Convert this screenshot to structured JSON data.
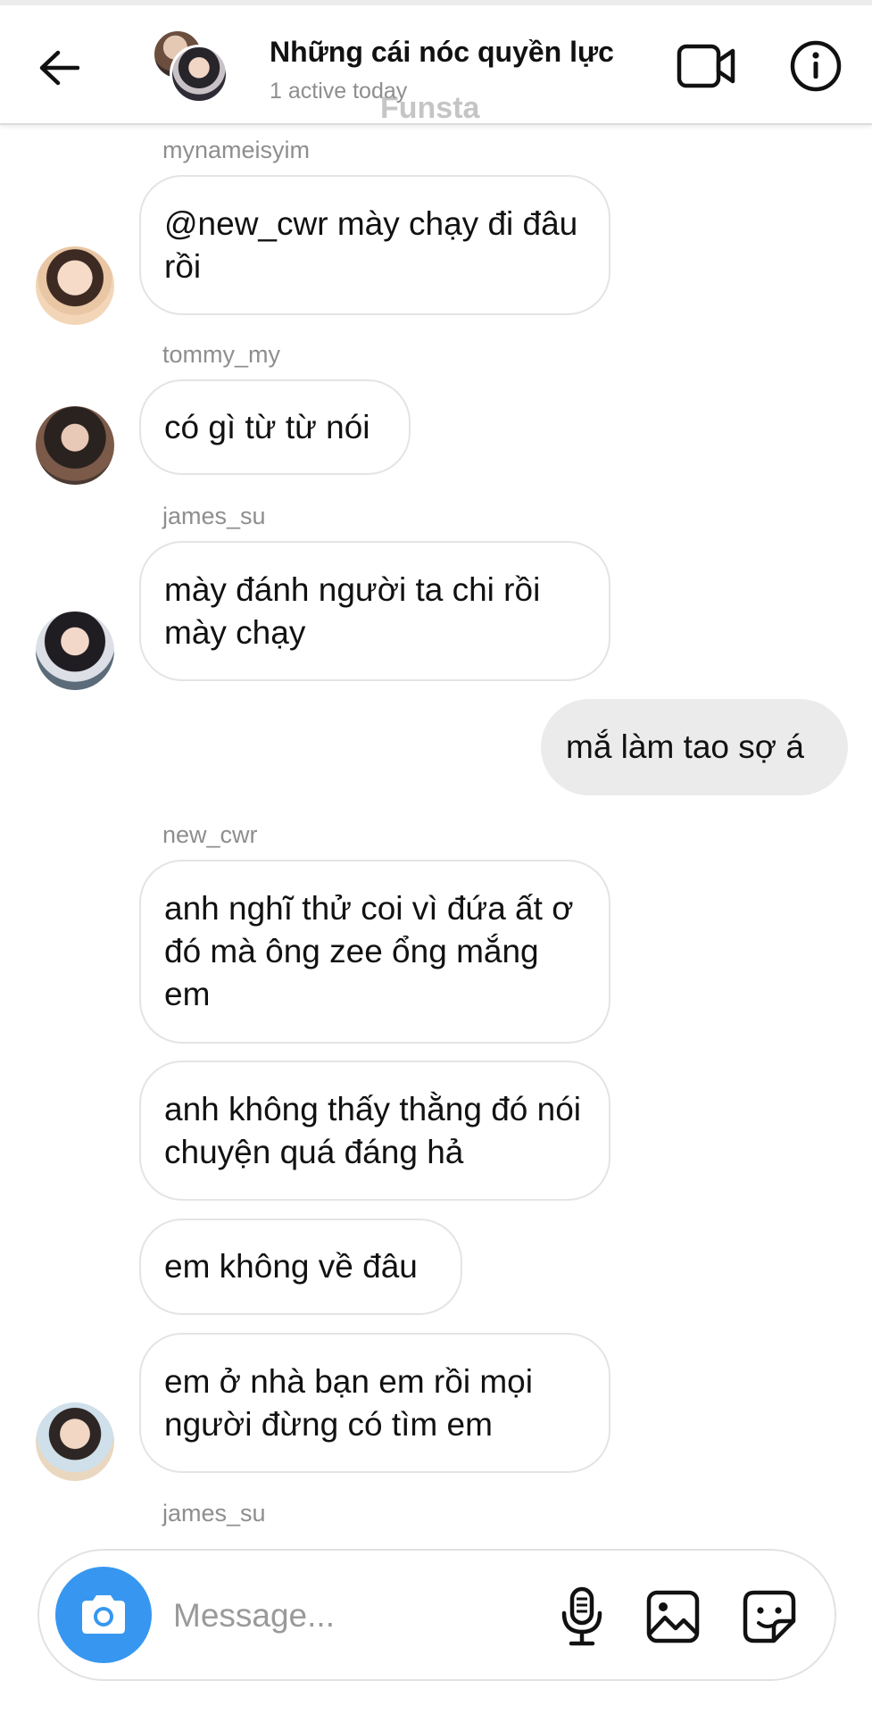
{
  "header": {
    "title": "Những cái nóc quyền lực",
    "subtitle": "1 active today",
    "watermark": "Funsta"
  },
  "messages": [
    {
      "username": "mynameisyim",
      "text": "@new_cwr mày chạy đi đâu rồi"
    },
    {
      "username": "tommy_my",
      "text": "có gì từ từ nói"
    },
    {
      "username": "james_su",
      "text": "mày đánh người ta chi rồi mày chạy"
    },
    {
      "text": "mắ làm tao sợ á",
      "mine": true
    },
    {
      "username": "new_cwr",
      "text": "anh nghĩ thử coi vì đứa ất ơ đó mà ông zee ổng mắng em"
    },
    {
      "text": "anh không thấy thằng đó nói chuyện quá đáng hả"
    },
    {
      "text": "em không về đâu"
    },
    {
      "text": "em ở nhà bạn em rồi mọi người đừng có tìm em"
    },
    {
      "username": "james_su"
    }
  ],
  "composer": {
    "placeholder": "Message..."
  },
  "icons": {
    "back": "arrow-left-icon",
    "video": "video-camera-icon",
    "info": "info-icon",
    "camera": "camera-icon",
    "mic": "microphone-icon",
    "gallery": "image-icon",
    "sticker": "sticker-icon"
  },
  "colors": {
    "accent": "#3797f0",
    "my_bubble": "#ebebeb",
    "muted_text": "#8e8e8e"
  }
}
